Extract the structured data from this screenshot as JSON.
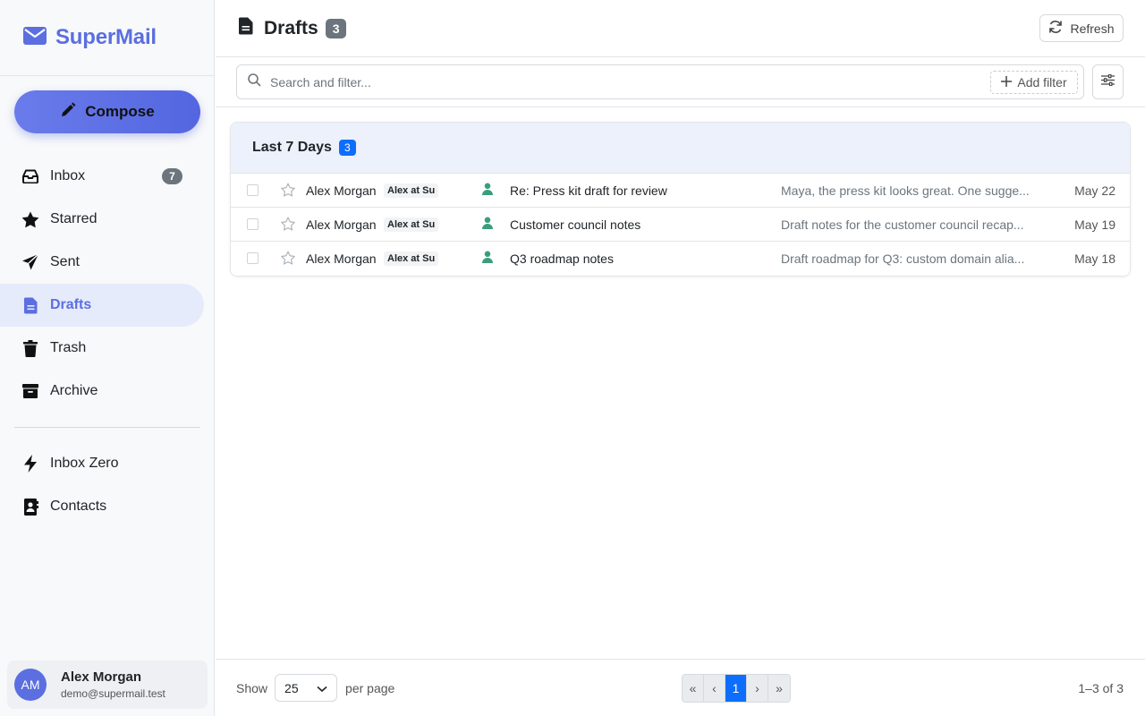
{
  "app": {
    "name": "SuperMail",
    "accent": "#5b6fe0"
  },
  "sidebar": {
    "compose_label": "Compose",
    "items": [
      {
        "label": "Inbox",
        "icon": "inbox-icon",
        "badge": "7"
      },
      {
        "label": "Starred",
        "icon": "star-icon"
      },
      {
        "label": "Sent",
        "icon": "send-icon"
      },
      {
        "label": "Drafts",
        "icon": "document-icon",
        "active": true
      },
      {
        "label": "Trash",
        "icon": "trash-icon"
      },
      {
        "label": "Archive",
        "icon": "archive-icon"
      }
    ],
    "extra_items": [
      {
        "label": "Inbox Zero",
        "icon": "lightning-icon"
      },
      {
        "label": "Contacts",
        "icon": "contacts-icon"
      }
    ],
    "user": {
      "initials": "AM",
      "name": "Alex Morgan",
      "email": "demo@supermail.test"
    }
  },
  "header": {
    "title": "Drafts",
    "count": "3",
    "refresh_label": "Refresh"
  },
  "filter": {
    "placeholder": "Search and filter...",
    "add_filter_label": "Add filter"
  },
  "group": {
    "title": "Last 7 Days",
    "count": "3",
    "rows": [
      {
        "sender": "Alex Morgan",
        "tag": "Alex at Su",
        "subject": "Re: Press kit draft for review",
        "snippet": "Maya, the press kit looks great. One sugge...",
        "date": "May 22"
      },
      {
        "sender": "Alex Morgan",
        "tag": "Alex at Su",
        "subject": "Customer council notes",
        "snippet": "Draft notes for the customer council recap...",
        "date": "May 19"
      },
      {
        "sender": "Alex Morgan",
        "tag": "Alex at Su",
        "subject": "Q3 roadmap notes",
        "snippet": "Draft roadmap for Q3: custom domain alia...",
        "date": "May 18"
      }
    ]
  },
  "footer": {
    "show_label": "Show",
    "per_page_value": "25",
    "per_page_label": "per page",
    "pager": {
      "first": "«",
      "prev": "‹",
      "current": "1",
      "next": "›",
      "last": "»"
    },
    "range": "1–3 of 3"
  }
}
